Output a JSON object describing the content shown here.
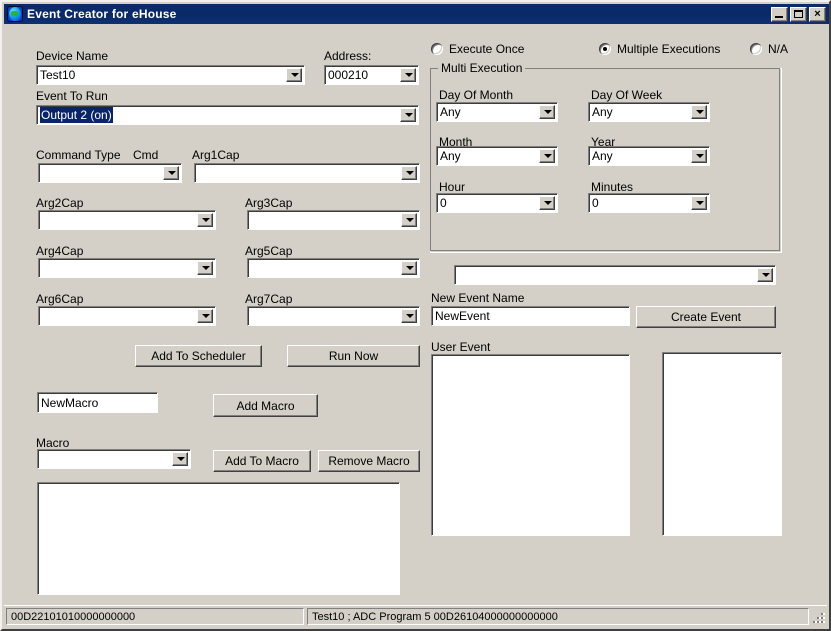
{
  "window": {
    "title": "Event Creator for eHouse",
    "icon": "globe-icon",
    "minimize_label": "_",
    "maximize_label": "",
    "close_label": "×"
  },
  "colors": {
    "titlebar": "#0a2a66",
    "face": "#d4d0c8",
    "selection": "#0a246a",
    "field": "#ffffff"
  },
  "device": {
    "name_label": "Device Name",
    "name_value": "Test10",
    "address_label": "Address:",
    "address_value": "000210",
    "event_to_run_label": "Event To Run",
    "event_to_run_value": "Output 2 (on)"
  },
  "command": {
    "command_type_label": "Command Type",
    "cmd_label": "Cmd",
    "command_type_value": "",
    "args": [
      {
        "label": "Arg1Cap",
        "value": ""
      },
      {
        "label": "Arg2Cap",
        "value": ""
      },
      {
        "label": "Arg3Cap",
        "value": ""
      },
      {
        "label": "Arg4Cap",
        "value": ""
      },
      {
        "label": "Arg5Cap",
        "value": ""
      },
      {
        "label": "Arg6Cap",
        "value": ""
      },
      {
        "label": "Arg7Cap",
        "value": ""
      }
    ]
  },
  "execution": {
    "once_label": "Execute Once",
    "multiple_label": "Multiple Executions",
    "na_label": "N/A",
    "selected": "multiple"
  },
  "multi_execution": {
    "legend": "Multi Execution",
    "fields": [
      {
        "label": "Day Of Month",
        "value": "Any"
      },
      {
        "label": "Day Of Week",
        "value": "Any"
      },
      {
        "label": "Month",
        "value": "Any"
      },
      {
        "label": "Year",
        "value": "Any"
      },
      {
        "label": "Hour",
        "value": "0"
      },
      {
        "label": "Minutes",
        "value": "0"
      }
    ]
  },
  "event": {
    "scheduler_combo_value": "",
    "new_event_name_label": "New Event Name",
    "new_event_name_value": "NewEvent",
    "create_event_label": "Create Event",
    "user_event_label": "User Event"
  },
  "actions": {
    "add_to_scheduler_label": "Add To Scheduler",
    "run_now_label": "Run Now",
    "macro_name_value": "NewMacro",
    "add_macro_label": "Add Macro",
    "macro_label": "Macro",
    "macro_combo_value": "",
    "add_to_macro_label": "Add To Macro",
    "remove_macro_label": "Remove Macro"
  },
  "lists": {
    "macro_content": "",
    "user_event_content": "",
    "side_list_content": ""
  },
  "statusbar": {
    "left_text": "00D22101010000000000",
    "right_text": "Test10 ; ADC Program 5 00D26104000000000000"
  }
}
